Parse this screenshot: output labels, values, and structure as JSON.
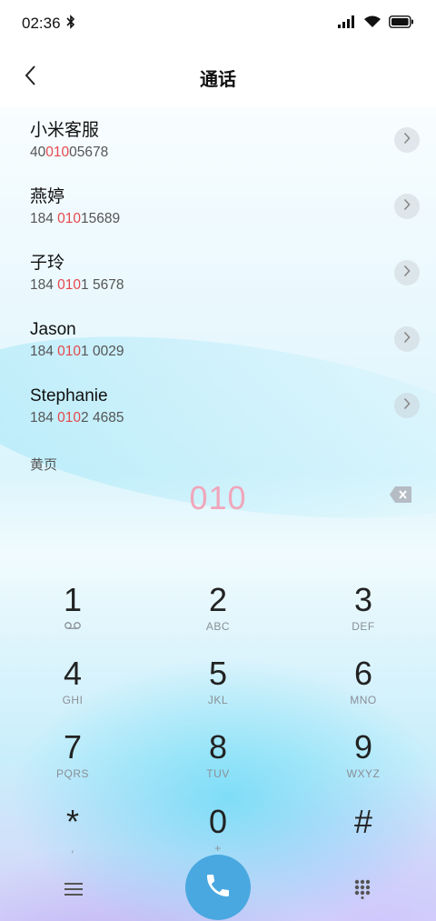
{
  "status_bar": {
    "time": "02:36"
  },
  "header": {
    "title": "通话"
  },
  "contacts": [
    {
      "name": "小米客服",
      "num_pre": "40",
      "num_hl": "010",
      "num_post": "05678"
    },
    {
      "name": "燕婷",
      "num_pre": "184 ",
      "num_hl": "010",
      "num_post": "15689"
    },
    {
      "name": "子玲",
      "num_pre": "184 ",
      "num_hl": "010",
      "num_post": "1 5678"
    },
    {
      "name": "Jason",
      "num_pre": "184 ",
      "num_hl": "010",
      "num_post": "1 0029"
    },
    {
      "name": "Stephanie",
      "num_pre": "184 ",
      "num_hl": "010",
      "num_post": "2 4685"
    }
  ],
  "section": {
    "label": "黄页"
  },
  "dialer": {
    "display": "010",
    "keys": [
      {
        "digit": "1",
        "sub": ""
      },
      {
        "digit": "2",
        "sub": "ABC"
      },
      {
        "digit": "3",
        "sub": "DEF"
      },
      {
        "digit": "4",
        "sub": "GHI"
      },
      {
        "digit": "5",
        "sub": "JKL"
      },
      {
        "digit": "6",
        "sub": "MNO"
      },
      {
        "digit": "7",
        "sub": "PQRS"
      },
      {
        "digit": "8",
        "sub": "TUV"
      },
      {
        "digit": "9",
        "sub": "WXYZ"
      },
      {
        "digit": "*",
        "sub": ","
      },
      {
        "digit": "0",
        "sub": "+"
      },
      {
        "digit": "#",
        "sub": ""
      }
    ]
  },
  "colors": {
    "accent": "#4aa8e0",
    "highlight": "#e5484d",
    "display_text": "#f0a6ba"
  },
  "icons": {
    "back": "chevron-left-icon",
    "chevron": "chevron-right-icon",
    "backspace": "backspace-icon",
    "voicemail": "voicemail-icon",
    "menu": "menu-icon",
    "call": "phone-icon",
    "keypad": "keypad-icon"
  }
}
